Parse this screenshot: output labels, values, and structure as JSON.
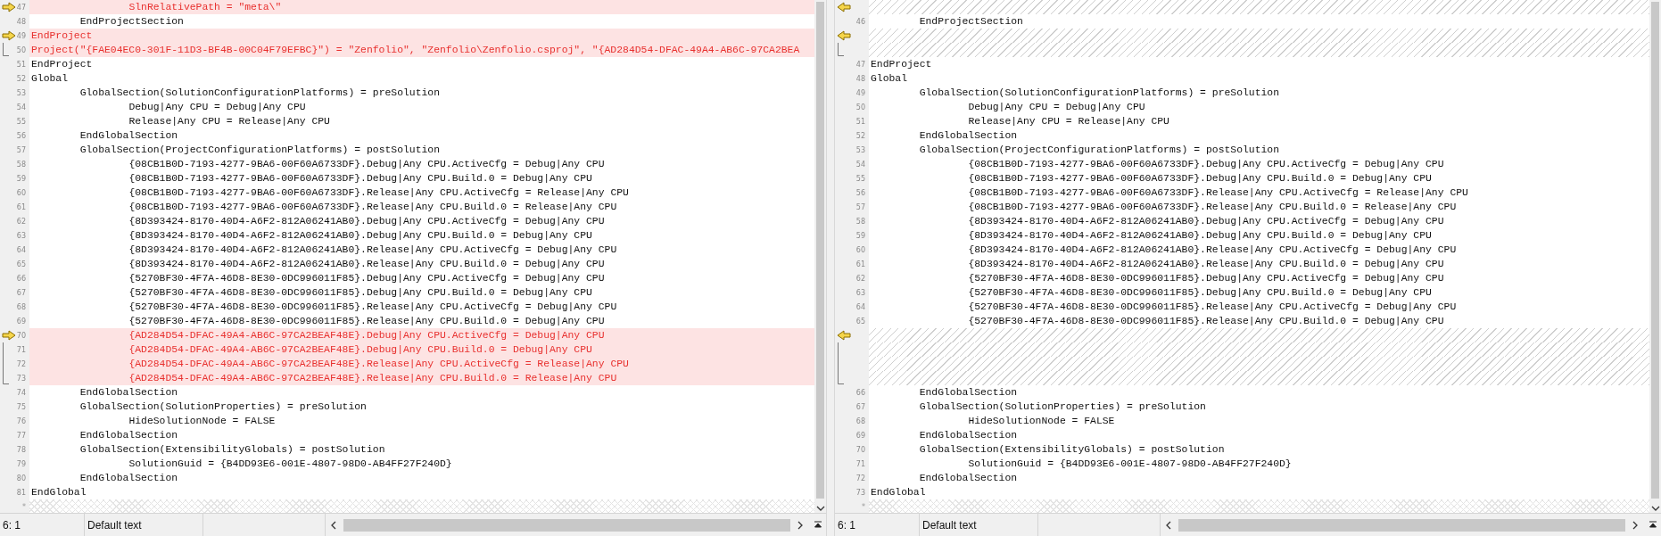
{
  "panes": [
    {
      "rows": [
        {
          "kind": "removed",
          "number": "47",
          "text": "\t\tSlnRelativePath = \"meta\\\"",
          "marker": {
            "kind": "arrow"
          }
        },
        {
          "kind": "normal",
          "number": "48",
          "text": "\tEndProjectSection"
        },
        {
          "kind": "removed",
          "number": "49",
          "text": "EndProject",
          "marker": {
            "kind": "arrow"
          }
        },
        {
          "kind": "removed",
          "number": "50",
          "text": "Project(\"{FAE04EC0-301F-11D3-BF4B-00C04F79EFBC}\") = \"Zenfolio\", \"Zenfolio\\Zenfolio.csproj\", \"{AD284D54-DFAC-49A4-AB6C-97CA2BEA",
          "marker": {
            "kind": "end"
          }
        },
        {
          "kind": "normal",
          "number": "51",
          "text": "EndProject"
        },
        {
          "kind": "normal",
          "number": "52",
          "text": "Global"
        },
        {
          "kind": "normal",
          "number": "53",
          "text": "\tGlobalSection(SolutionConfigurationPlatforms) = preSolution"
        },
        {
          "kind": "normal",
          "number": "54",
          "text": "\t\tDebug|Any CPU = Debug|Any CPU"
        },
        {
          "kind": "normal",
          "number": "55",
          "text": "\t\tRelease|Any CPU = Release|Any CPU"
        },
        {
          "kind": "normal",
          "number": "56",
          "text": "\tEndGlobalSection"
        },
        {
          "kind": "normal",
          "number": "57",
          "text": "\tGlobalSection(ProjectConfigurationPlatforms) = postSolution"
        },
        {
          "kind": "normal",
          "number": "58",
          "text": "\t\t{08CB1B0D-7193-4277-9BA6-00F60A6733DF}.Debug|Any CPU.ActiveCfg = Debug|Any CPU"
        },
        {
          "kind": "normal",
          "number": "59",
          "text": "\t\t{08CB1B0D-7193-4277-9BA6-00F60A6733DF}.Debug|Any CPU.Build.0 = Debug|Any CPU"
        },
        {
          "kind": "normal",
          "number": "60",
          "text": "\t\t{08CB1B0D-7193-4277-9BA6-00F60A6733DF}.Release|Any CPU.ActiveCfg = Release|Any CPU"
        },
        {
          "kind": "normal",
          "number": "61",
          "text": "\t\t{08CB1B0D-7193-4277-9BA6-00F60A6733DF}.Release|Any CPU.Build.0 = Release|Any CPU"
        },
        {
          "kind": "normal",
          "number": "62",
          "text": "\t\t{8D393424-8170-40D4-A6F2-812A06241AB0}.Debug|Any CPU.ActiveCfg = Debug|Any CPU"
        },
        {
          "kind": "normal",
          "number": "63",
          "text": "\t\t{8D393424-8170-40D4-A6F2-812A06241AB0}.Debug|Any CPU.Build.0 = Debug|Any CPU"
        },
        {
          "kind": "normal",
          "number": "64",
          "text": "\t\t{8D393424-8170-40D4-A6F2-812A06241AB0}.Release|Any CPU.ActiveCfg = Debug|Any CPU"
        },
        {
          "kind": "normal",
          "number": "65",
          "text": "\t\t{8D393424-8170-40D4-A6F2-812A06241AB0}.Release|Any CPU.Build.0 = Debug|Any CPU"
        },
        {
          "kind": "normal",
          "number": "66",
          "text": "\t\t{5270BF30-4F7A-46D8-8E30-0DC996011F85}.Debug|Any CPU.ActiveCfg = Debug|Any CPU"
        },
        {
          "kind": "normal",
          "number": "67",
          "text": "\t\t{5270BF30-4F7A-46D8-8E30-0DC996011F85}.Debug|Any CPU.Build.0 = Debug|Any CPU"
        },
        {
          "kind": "normal",
          "number": "68",
          "text": "\t\t{5270BF30-4F7A-46D8-8E30-0DC996011F85}.Release|Any CPU.ActiveCfg = Debug|Any CPU"
        },
        {
          "kind": "normal",
          "number": "69",
          "text": "\t\t{5270BF30-4F7A-46D8-8E30-0DC996011F85}.Release|Any CPU.Build.0 = Debug|Any CPU"
        },
        {
          "kind": "removed",
          "number": "70",
          "text": "\t\t{AD284D54-DFAC-49A4-AB6C-97CA2BEAF48E}.Debug|Any CPU.ActiveCfg = Debug|Any CPU",
          "marker": {
            "kind": "arrow"
          }
        },
        {
          "kind": "removed",
          "number": "71",
          "text": "\t\t{AD284D54-DFAC-49A4-AB6C-97CA2BEAF48E}.Debug|Any CPU.Build.0 = Debug|Any CPU",
          "marker": {
            "kind": "continue"
          }
        },
        {
          "kind": "removed",
          "number": "72",
          "text": "\t\t{AD284D54-DFAC-49A4-AB6C-97CA2BEAF48E}.Release|Any CPU.ActiveCfg = Release|Any CPU",
          "marker": {
            "kind": "continue"
          }
        },
        {
          "kind": "removed",
          "number": "73",
          "text": "\t\t{AD284D54-DFAC-49A4-AB6C-97CA2BEAF48E}.Release|Any CPU.Build.0 = Release|Any CPU",
          "marker": {
            "kind": "end"
          }
        },
        {
          "kind": "normal",
          "number": "74",
          "text": "\tEndGlobalSection"
        },
        {
          "kind": "normal",
          "number": "75",
          "text": "\tGlobalSection(SolutionProperties) = preSolution"
        },
        {
          "kind": "normal",
          "number": "76",
          "text": "\t\tHideSolutionNode = FALSE"
        },
        {
          "kind": "normal",
          "number": "77",
          "text": "\tEndGlobalSection"
        },
        {
          "kind": "normal",
          "number": "78",
          "text": "\tGlobalSection(ExtensibilityGlobals) = postSolution"
        },
        {
          "kind": "normal",
          "number": "79",
          "text": "\t\tSolutionGuid = {B4DD93E6-001E-4807-98D0-AB4FF27F240D}"
        },
        {
          "kind": "normal",
          "number": "80",
          "text": "\tEndGlobalSection"
        },
        {
          "kind": "normal",
          "number": "81",
          "text": "EndGlobal"
        }
      ],
      "end_marker": "*",
      "status": {
        "position": "6: 1",
        "mode": "Default text"
      }
    },
    {
      "rows": [
        {
          "kind": "gap",
          "marker": {
            "kind": "arrow"
          }
        },
        {
          "kind": "normal",
          "number": "46",
          "text": "\tEndProjectSection"
        },
        {
          "kind": "gap",
          "marker": {
            "kind": "arrow"
          }
        },
        {
          "kind": "gap",
          "marker": {
            "kind": "end"
          }
        },
        {
          "kind": "normal",
          "number": "47",
          "text": "EndProject"
        },
        {
          "kind": "normal",
          "number": "48",
          "text": "Global"
        },
        {
          "kind": "normal",
          "number": "49",
          "text": "\tGlobalSection(SolutionConfigurationPlatforms) = preSolution"
        },
        {
          "kind": "normal",
          "number": "50",
          "text": "\t\tDebug|Any CPU = Debug|Any CPU"
        },
        {
          "kind": "normal",
          "number": "51",
          "text": "\t\tRelease|Any CPU = Release|Any CPU"
        },
        {
          "kind": "normal",
          "number": "52",
          "text": "\tEndGlobalSection"
        },
        {
          "kind": "normal",
          "number": "53",
          "text": "\tGlobalSection(ProjectConfigurationPlatforms) = postSolution"
        },
        {
          "kind": "normal",
          "number": "54",
          "text": "\t\t{08CB1B0D-7193-4277-9BA6-00F60A6733DF}.Debug|Any CPU.ActiveCfg = Debug|Any CPU"
        },
        {
          "kind": "normal",
          "number": "55",
          "text": "\t\t{08CB1B0D-7193-4277-9BA6-00F60A6733DF}.Debug|Any CPU.Build.0 = Debug|Any CPU"
        },
        {
          "kind": "normal",
          "number": "56",
          "text": "\t\t{08CB1B0D-7193-4277-9BA6-00F60A6733DF}.Release|Any CPU.ActiveCfg = Release|Any CPU"
        },
        {
          "kind": "normal",
          "number": "57",
          "text": "\t\t{08CB1B0D-7193-4277-9BA6-00F60A6733DF}.Release|Any CPU.Build.0 = Release|Any CPU"
        },
        {
          "kind": "normal",
          "number": "58",
          "text": "\t\t{8D393424-8170-40D4-A6F2-812A06241AB0}.Debug|Any CPU.ActiveCfg = Debug|Any CPU"
        },
        {
          "kind": "normal",
          "number": "59",
          "text": "\t\t{8D393424-8170-40D4-A6F2-812A06241AB0}.Debug|Any CPU.Build.0 = Debug|Any CPU"
        },
        {
          "kind": "normal",
          "number": "60",
          "text": "\t\t{8D393424-8170-40D4-A6F2-812A06241AB0}.Release|Any CPU.ActiveCfg = Debug|Any CPU"
        },
        {
          "kind": "normal",
          "number": "61",
          "text": "\t\t{8D393424-8170-40D4-A6F2-812A06241AB0}.Release|Any CPU.Build.0 = Debug|Any CPU"
        },
        {
          "kind": "normal",
          "number": "62",
          "text": "\t\t{5270BF30-4F7A-46D8-8E30-0DC996011F85}.Debug|Any CPU.ActiveCfg = Debug|Any CPU"
        },
        {
          "kind": "normal",
          "number": "63",
          "text": "\t\t{5270BF30-4F7A-46D8-8E30-0DC996011F85}.Debug|Any CPU.Build.0 = Debug|Any CPU"
        },
        {
          "kind": "normal",
          "number": "64",
          "text": "\t\t{5270BF30-4F7A-46D8-8E30-0DC996011F85}.Release|Any CPU.ActiveCfg = Debug|Any CPU"
        },
        {
          "kind": "normal",
          "number": "65",
          "text": "\t\t{5270BF30-4F7A-46D8-8E30-0DC996011F85}.Release|Any CPU.Build.0 = Debug|Any CPU"
        },
        {
          "kind": "gap",
          "marker": {
            "kind": "arrow"
          }
        },
        {
          "kind": "gap",
          "marker": {
            "kind": "continue"
          }
        },
        {
          "kind": "gap",
          "marker": {
            "kind": "continue"
          }
        },
        {
          "kind": "gap",
          "marker": {
            "kind": "end"
          }
        },
        {
          "kind": "normal",
          "number": "66",
          "text": "\tEndGlobalSection"
        },
        {
          "kind": "normal",
          "number": "67",
          "text": "\tGlobalSection(SolutionProperties) = preSolution"
        },
        {
          "kind": "normal",
          "number": "68",
          "text": "\t\tHideSolutionNode = FALSE"
        },
        {
          "kind": "normal",
          "number": "69",
          "text": "\tEndGlobalSection"
        },
        {
          "kind": "normal",
          "number": "70",
          "text": "\tGlobalSection(ExtensibilityGlobals) = postSolution"
        },
        {
          "kind": "normal",
          "number": "71",
          "text": "\t\tSolutionGuid = {B4DD93E6-001E-4807-98D0-AB4FF27F240D}"
        },
        {
          "kind": "normal",
          "number": "72",
          "text": "\tEndGlobalSection"
        },
        {
          "kind": "normal",
          "number": "73",
          "text": "EndGlobal"
        }
      ],
      "end_marker": "*",
      "status": {
        "position": "6: 1",
        "mode": "Default text"
      }
    }
  ]
}
